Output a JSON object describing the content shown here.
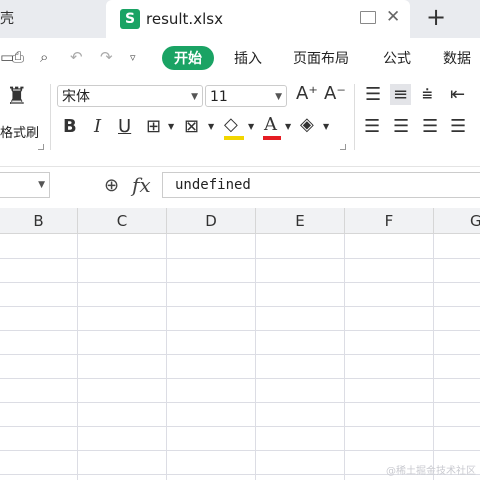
{
  "tabs": {
    "left_tab_label": "壳",
    "active_file_name": "result.xlsx",
    "file_icon_letter": "S",
    "add_tab_symbol": "+"
  },
  "menu": {
    "items": [
      "开始",
      "插入",
      "页面布局",
      "公式",
      "数据"
    ],
    "active_index": 0
  },
  "ribbon": {
    "format_painter_label": "格式刷",
    "font_name": "宋体",
    "font_size": "11"
  },
  "formula_bar": {
    "name_box_value": "",
    "fx_label": "fx",
    "formula_value": "undefined"
  },
  "sheet": {
    "columns": [
      "B",
      "C",
      "D",
      "E",
      "F",
      "G"
    ]
  },
  "watermark": "@稀土掘金技术社区",
  "colors": {
    "accent": "#1aa364",
    "tabbar_bg": "#e9ebef",
    "header_bg": "#f1f2f4",
    "gridline": "#dcdde4"
  }
}
